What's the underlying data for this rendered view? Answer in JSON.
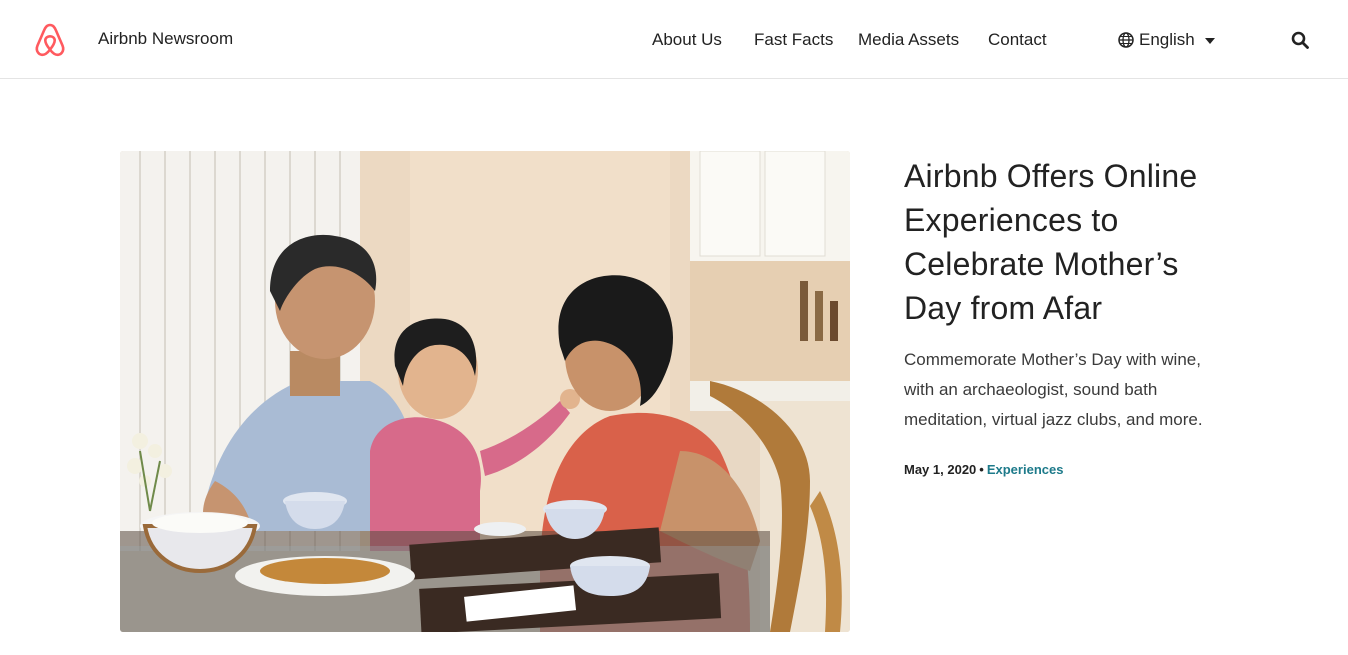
{
  "header": {
    "brand": "Airbnb Newsroom",
    "logo_icon": "airbnb-belo-icon",
    "brand_color": "#FF5A5F",
    "nav": [
      {
        "label": "About Us"
      },
      {
        "label": "Fast Facts"
      },
      {
        "label": "Media Assets"
      },
      {
        "label": "Contact"
      }
    ],
    "language": {
      "icon": "globe-icon",
      "label": "English"
    },
    "search_icon": "search-icon"
  },
  "article": {
    "image_alt": "Family sharing a meal at a dining table",
    "title": "Airbnb Offers Online Experiences to Celebrate Mother’s Day from Afar",
    "description": "Commemorate Mother’s Day with wine, with an archaeologist, sound bath meditation, virtual jazz clubs, and more.",
    "date": "May 1, 2020",
    "separator": "•",
    "category": "Experiences",
    "category_color": "#1d7a8a"
  }
}
